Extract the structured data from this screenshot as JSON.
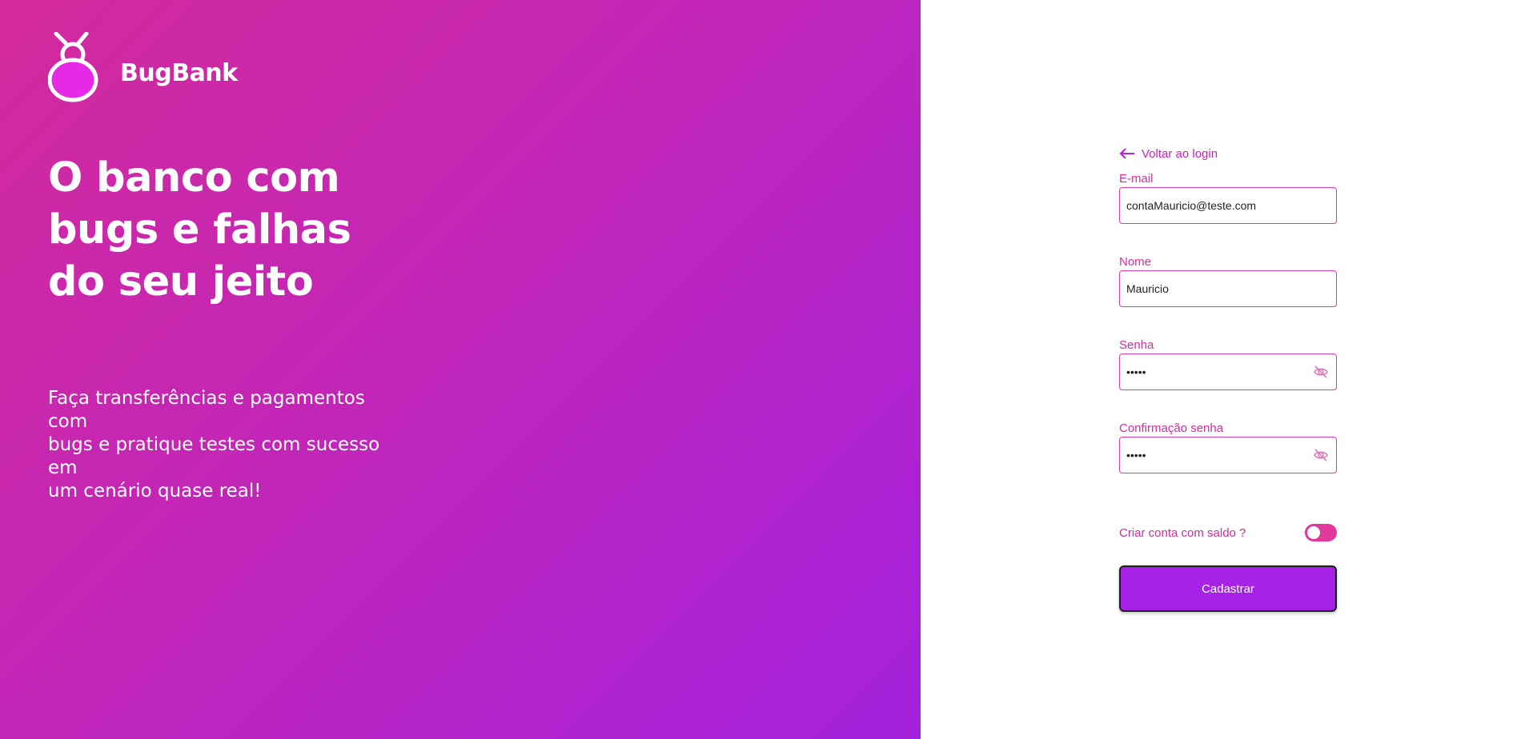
{
  "brand": {
    "name": "BugBank",
    "gradient_start": "#d32a9c",
    "gradient_end": "#a321dd"
  },
  "hero": {
    "headline_lines": [
      "O banco com",
      "bugs e falhas",
      "do seu jeito"
    ],
    "subtitle_lines": [
      "Faça transferências e pagamentos com",
      "bugs e pratique testes com sucesso em",
      "um cenário quase real!"
    ]
  },
  "form": {
    "back_link": "Voltar ao login",
    "email": {
      "label": "E-mail",
      "value": "contaMauricio@teste.com"
    },
    "name": {
      "label": "Nome",
      "value": "Mauricio"
    },
    "password": {
      "label": "Senha",
      "value": "•••••"
    },
    "password_confirm": {
      "label": "Confirmação senha",
      "value": "•••••"
    },
    "balance_toggle": {
      "label": "Criar conta com saldo ?",
      "on": false
    },
    "submit_label": "Cadastrar",
    "accent": "#d93b9e",
    "button_color": "#a622e6"
  },
  "icons": {
    "back": "arrow-left-icon",
    "password_visibility": "eye-off-icon",
    "logo": "bug-logo-icon"
  }
}
